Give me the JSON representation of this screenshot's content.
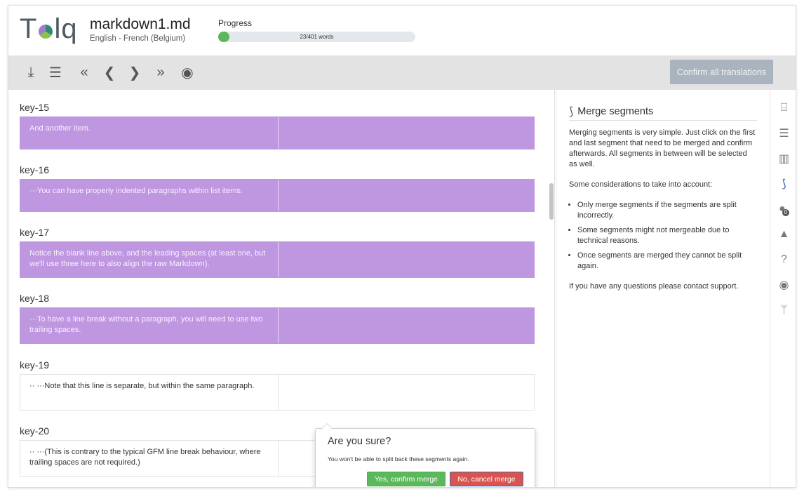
{
  "app": {
    "logo_text_left": "T",
    "logo_text_right": "lq",
    "file_name": "markdown1.md",
    "language_pair": "English - French (Belgium)"
  },
  "progress": {
    "label": "Progress",
    "text": "23/401 words",
    "done": 23,
    "total": 401,
    "color": "#5cb85c"
  },
  "toolbar": {
    "icons": [
      "download-icon",
      "segment-list-icon",
      "first-icon",
      "previous-icon",
      "next-icon",
      "last-icon",
      "preview-icon"
    ],
    "icon_glyphs": [
      "⤓",
      "☰",
      "«",
      "❮",
      "❯",
      "»",
      "◉"
    ],
    "confirm_all_label": "Confirm all translations"
  },
  "segments": [
    {
      "key": "key-15",
      "source": "And another item.",
      "target": "",
      "selected": true
    },
    {
      "key": "key-16",
      "source": "···You can have properly indented paragraphs within list items.",
      "target": "",
      "selected": true
    },
    {
      "key": "key-17",
      "source": "Notice the blank line above, and the leading spaces (at least one, but we'll use three here to also align the raw Markdown).",
      "target": "",
      "selected": true
    },
    {
      "key": "key-18",
      "source": "···To have a line break without a paragraph, you will need to use two trailing spaces.",
      "target": "",
      "selected": true
    },
    {
      "key": "key-19",
      "source": "·· ···Note that this line is separate, but within the same paragraph.",
      "target": "",
      "selected": false
    },
    {
      "key": "key-20",
      "source": "·· ···(This is contrary to the typical GFM line break behaviour, where trailing spaces are not required.)",
      "target": "",
      "selected": false
    }
  ],
  "colors": {
    "selected_segment": "#bf96e0",
    "confirm_yes": "#5cb85c",
    "confirm_no": "#d9534f",
    "toolbar_bg": "#e3e3e3"
  },
  "panel": {
    "icon": "merge-icon",
    "title": "Merge segments",
    "intro": "Merging segments is very simple. Just click on the first and last segment that need to be merged and confirm afterwards. All segments in between will be selected as well.",
    "considerations_heading": "Some considerations to take into account:",
    "considerations": [
      "Only merge segments if the segments are split incorrectly.",
      "Some segments might not mergeable due to technical reasons.",
      "Once segments are merged they cannot be split again."
    ],
    "footer": "If you have any questions please contact support."
  },
  "rail": {
    "icons": [
      "translate-icon",
      "list-icon",
      "book-icon",
      "merge-icon",
      "comments-icon",
      "warning-icon",
      "help-icon",
      "eye-icon",
      "branch-icon"
    ],
    "glyphs": [
      "⌸",
      "☰",
      "▥",
      "⟆",
      "●",
      "▲",
      "?",
      "◉",
      "ᛘ"
    ],
    "comments_badge": "0"
  },
  "popover": {
    "title": "Are you sure?",
    "message": "You won't be able to split back these segments again.",
    "confirm_label": "Yes, confirm merge",
    "cancel_label": "No, cancel merge"
  }
}
